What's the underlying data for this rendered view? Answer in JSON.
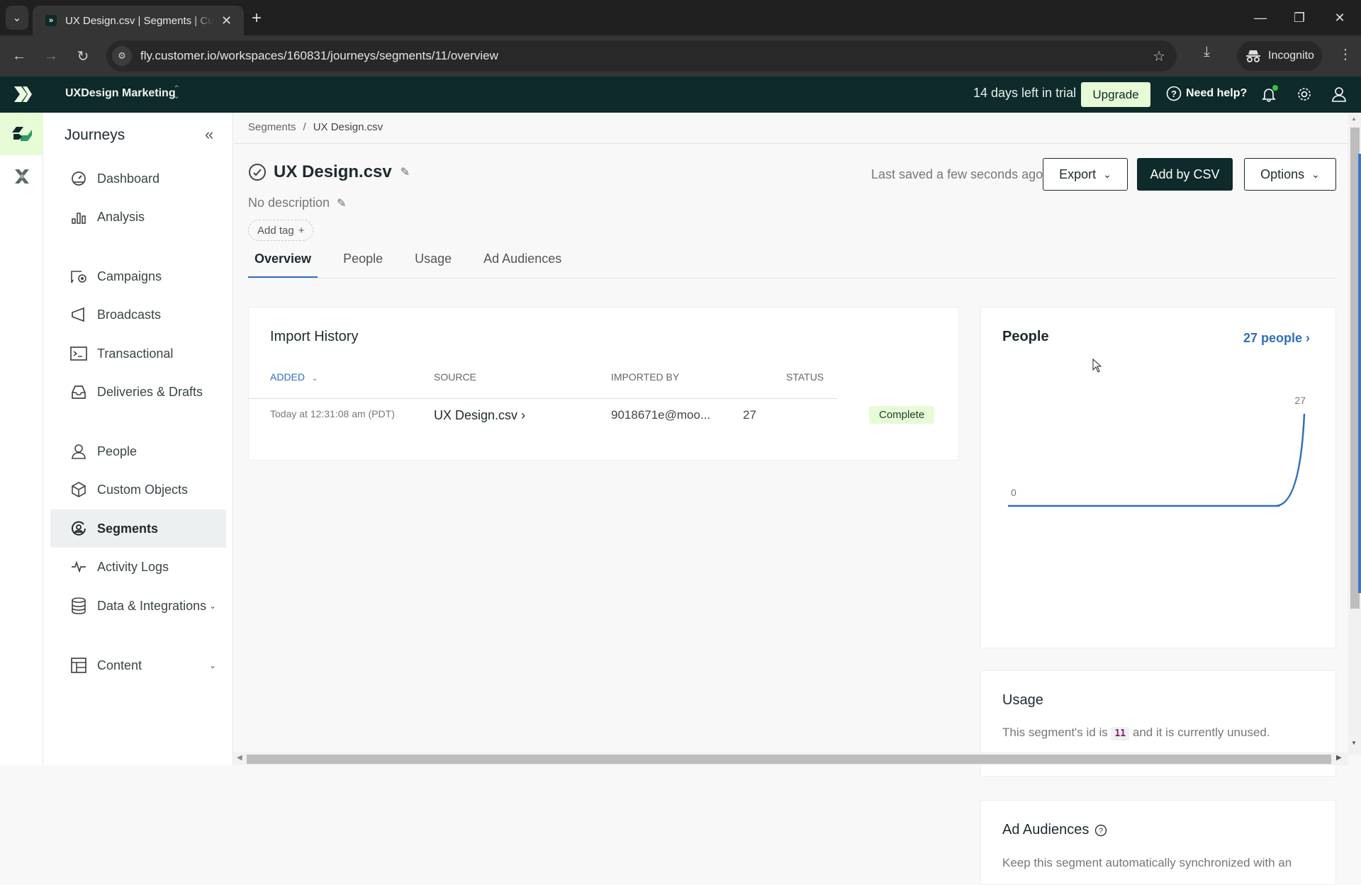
{
  "browser": {
    "tab_title": "UX Design.csv | Segments | Customer.io",
    "url": "fly.customer.io/workspaces/160831/journeys/segments/11/overview",
    "profile_label": "Incognito"
  },
  "header": {
    "workspace": "UXDesign Marketing",
    "trial_text": "14 days left in trial",
    "upgrade_label": "Upgrade",
    "help_label": "Need help?"
  },
  "sidebar": {
    "title": "Journeys",
    "items": [
      {
        "label": "Dashboard",
        "icon": "dashboard-icon"
      },
      {
        "label": "Analysis",
        "icon": "bar-chart-icon"
      },
      {
        "label": "Campaigns",
        "icon": "campaigns-icon"
      },
      {
        "label": "Broadcasts",
        "icon": "megaphone-icon"
      },
      {
        "label": "Transactional",
        "icon": "terminal-icon"
      },
      {
        "label": "Deliveries & Drafts",
        "icon": "inbox-icon"
      },
      {
        "label": "People",
        "icon": "person-icon"
      },
      {
        "label": "Custom Objects",
        "icon": "cube-icon"
      },
      {
        "label": "Segments",
        "icon": "segment-icon",
        "active": true
      },
      {
        "label": "Activity Logs",
        "icon": "pulse-icon"
      },
      {
        "label": "Data & Integrations",
        "icon": "database-icon",
        "expandable": true
      },
      {
        "label": "Content",
        "icon": "layout-icon",
        "expandable": true
      }
    ]
  },
  "breadcrumb": {
    "parent": "Segments",
    "separator": "/",
    "current": "UX Design.csv"
  },
  "segment": {
    "title": "UX Design.csv",
    "description": "No description",
    "add_tag_label": "Add tag",
    "last_saved": "Last saved a few seconds ago"
  },
  "actions": {
    "export": "Export",
    "add_csv": "Add by CSV",
    "options": "Options"
  },
  "tabs": [
    {
      "label": "Overview",
      "active": true
    },
    {
      "label": "People"
    },
    {
      "label": "Usage"
    },
    {
      "label": "Ad Audiences"
    }
  ],
  "import_history": {
    "title": "Import History",
    "columns": [
      "ADDED",
      "SOURCE",
      "IMPORTED BY",
      "STATUS"
    ],
    "rows": [
      {
        "added": "Today at 12:31:08 am (PDT)",
        "source": "UX Design.csv",
        "imported_by": "9018671e@moo...",
        "count": "27",
        "status": "Complete"
      }
    ]
  },
  "people_card": {
    "title": "People",
    "link": "27 people",
    "colors": {
      "line": "#2f6fbd"
    }
  },
  "chart_data": {
    "type": "line",
    "title": "People",
    "x": [
      0,
      1,
      2,
      3,
      4,
      5,
      6,
      7,
      8,
      9,
      10,
      11,
      12
    ],
    "series": [
      {
        "name": "People",
        "values": [
          0,
          0,
          0,
          0,
          0,
          0,
          0,
          0,
          0,
          0,
          0,
          0,
          27
        ]
      }
    ],
    "labels": {
      "min": "0",
      "max": "27"
    },
    "ylim": [
      0,
      27
    ],
    "grid": false
  },
  "usage_card": {
    "title": "Usage",
    "text_before": "This segment's id is",
    "segment_id": "11",
    "text_after": "and it is currently unused."
  },
  "ad_audiences_card": {
    "title": "Ad Audiences",
    "text": "Keep this segment automatically synchronized with an"
  }
}
